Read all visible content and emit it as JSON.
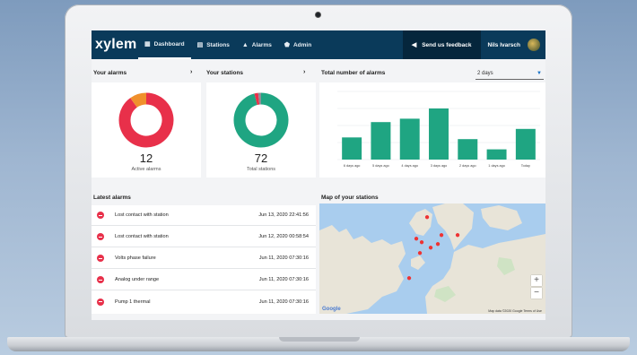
{
  "nav": {
    "logo": "xylem",
    "items": [
      {
        "label": "Dashboard",
        "icon": "dashboard-icon",
        "active": true
      },
      {
        "label": "Stations",
        "icon": "stations-icon",
        "active": false
      },
      {
        "label": "Alarms",
        "icon": "bell-icon",
        "active": false
      },
      {
        "label": "Admin",
        "icon": "admin-icon",
        "active": false
      }
    ],
    "feedback_label": "Send us feedback",
    "user_name": "Nils Ivarsch"
  },
  "your_alarms": {
    "title": "Your alarms",
    "count": "12",
    "label": "Active alarms",
    "segments": [
      {
        "value": 10,
        "color": "#e8304a"
      },
      {
        "value": 1.1,
        "color": "#f0902c"
      }
    ]
  },
  "your_stations": {
    "title": "Your stations",
    "count": "72",
    "label": "Total stations",
    "segments": [
      {
        "value": 68,
        "color": "#1fa582"
      },
      {
        "value": 1.6,
        "color": "#e8304a"
      },
      {
        "value": 1.2,
        "color": "#8a8f96"
      }
    ]
  },
  "total_alarms": {
    "title": "Total number of alarms",
    "period": "2 days",
    "chart_data": {
      "type": "bar",
      "categories": [
        "6 days ago",
        "5 days ago",
        "4 days ago",
        "3 days ago",
        "2 days ago",
        "1 days ago",
        "Today"
      ],
      "values": [
        13,
        22,
        24,
        30,
        12,
        6,
        18
      ],
      "ylim": [
        0,
        40
      ],
      "color": "#1fa582"
    }
  },
  "latest_alarms": {
    "title": "Latest alarms",
    "rows": [
      {
        "text": "Lost contact with station",
        "time": "Jun 13, 2020 22:41:56"
      },
      {
        "text": "Lost contact with station",
        "time": "Jun 12, 2020 00:58:54"
      },
      {
        "text": "Volts phase failure",
        "time": "Jun 11, 2020 07:30:16"
      },
      {
        "text": "Analog under range",
        "time": "Jun 11, 2020 07:30:16"
      },
      {
        "text": "Pump 1 thermal",
        "time": "Jun 11, 2020 07:30:16"
      }
    ]
  },
  "map": {
    "title": "Map of your stations",
    "zoom_in": "+",
    "zoom_out": "−",
    "provider": "Google",
    "terms": "Map data ©2020 Google  Terms of Use"
  }
}
